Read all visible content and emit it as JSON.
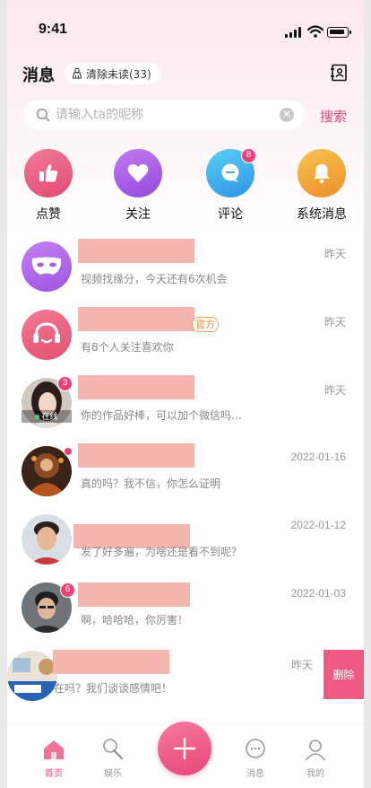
{
  "status_bar": {
    "time": "9:41"
  },
  "header": {
    "title": "消息",
    "clear_unread_label": "清除未读(33)"
  },
  "search": {
    "placeholder": "请输入ta的昵称",
    "button_label": "搜索"
  },
  "quick_actions": [
    {
      "label": "点赞",
      "icon": "thumbs-up-icon",
      "color": "#ec5a80"
    },
    {
      "label": "关注",
      "icon": "heart-icon",
      "color": "#a95ae6"
    },
    {
      "label": "评论",
      "icon": "comment-icon",
      "color": "#3fb2ec",
      "badge": "8"
    },
    {
      "label": "系统消息",
      "icon": "bell-icon",
      "color": "#f3a43f"
    }
  ],
  "messages": [
    {
      "preview": "视频找缘分，今天还有6次机会",
      "time": "昨天",
      "avatar": "mask-icon"
    },
    {
      "preview": "有8个人关注喜欢你",
      "time": "昨天",
      "avatar": "headset-icon",
      "tag": "官方"
    },
    {
      "preview": "你的作品好棒，可以加个微信吗...",
      "time": "昨天",
      "badge": "3",
      "online": "在线"
    },
    {
      "preview": "真的吗？我不信，你怎么证明",
      "time": "2022-01-16"
    },
    {
      "preview": "发了好多遍，为啥还是看不到呢？",
      "time": "2022-01-12"
    },
    {
      "preview": "啊，哈哈哈，你厉害！",
      "time": "2022-01-03",
      "badge": "6"
    },
    {
      "preview": "在吗？我们谈谈感情吧！",
      "time": "昨天"
    }
  ],
  "delete_label": "删除",
  "tabbar": [
    {
      "label": "首页",
      "icon": "home-icon",
      "active": true
    },
    {
      "label": "娱乐",
      "icon": "microphone-icon"
    },
    {
      "label": "",
      "icon": "plus-icon"
    },
    {
      "label": "消息",
      "icon": "chat-icon"
    },
    {
      "label": "我的",
      "icon": "user-icon"
    }
  ],
  "colors": {
    "accent": "#e8447a",
    "name_mask": "#f5b6b0"
  }
}
